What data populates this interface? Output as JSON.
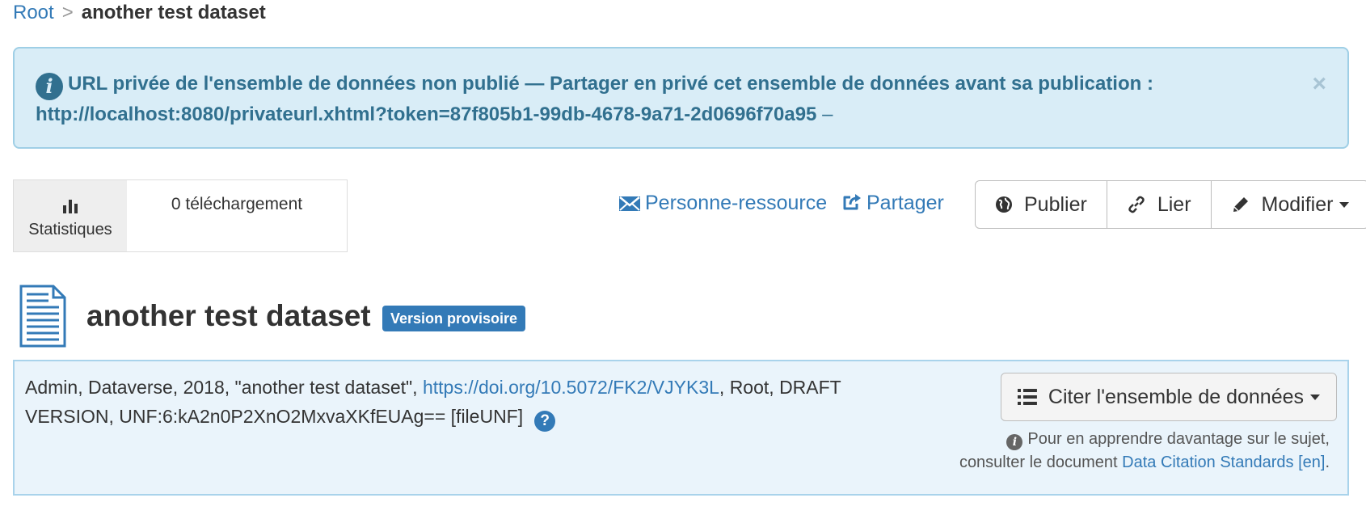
{
  "breadcrumb": {
    "root": "Root",
    "separator": ">",
    "current": "another test dataset"
  },
  "alert": {
    "message": "URL privée de l'ensemble de données non publié — Partager en privé cet ensemble de données avant sa publication :",
    "url": "http://localhost:8080/privateurl.xhtml?token=87f805b1-99db-4678-9a71-2d0696f70a95",
    "trailing": " –",
    "close": "×"
  },
  "metrics": {
    "tab_label": "Statistiques",
    "downloads": "0 téléchargement"
  },
  "actions": {
    "contact": "Personne-ressource",
    "share": "Partager",
    "publish": "Publier",
    "link": "Lier",
    "edit": "Modifier"
  },
  "dataset": {
    "title": "another test dataset",
    "badge": "Version provisoire"
  },
  "citation": {
    "prefix": "Admin, Dataverse, 2018, \"another test dataset\", ",
    "doi": "https://doi.org/10.5072/FK2/VJYK3L",
    "suffix": ", Root, DRAFT VERSION, UNF:6:kA2n0P2XnO2MxvaXKfEUAg== [fileUNF]",
    "help": "?",
    "button": "Citer l'ensemble de données",
    "note_line1": "Pour en apprendre davantage sur le sujet,",
    "note_line2_prefix": "consulter le document ",
    "note_link": "Data Citation Standards [en]",
    "note_end": "."
  },
  "colors": {
    "link": "#337ab7",
    "alert_bg": "#d9edf7",
    "alert_text": "#31708f",
    "badge_bg": "#337ab7"
  }
}
